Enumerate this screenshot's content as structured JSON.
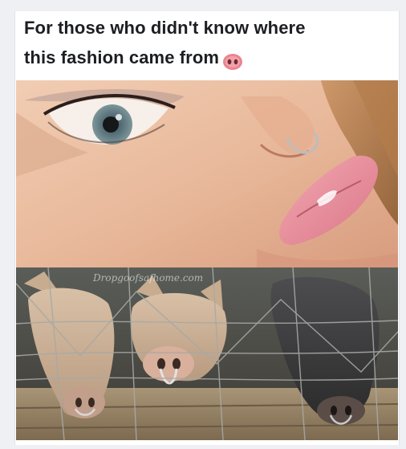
{
  "post": {
    "caption_line1": "For those who didn't know where",
    "caption_line2": "this fashion came from",
    "emoji_icon": "pig-nose-emoji-icon"
  },
  "images": {
    "top": "woman-with-nose-ring",
    "bottom": "pigs-with-nose-rings",
    "watermark": "Dropgoofsafhome.com"
  },
  "colors": {
    "caption_text": "#1c1e21",
    "card_bg": "#ffffff",
    "page_bg": "#eef0f3",
    "emoji_pink": "#e9858f"
  }
}
